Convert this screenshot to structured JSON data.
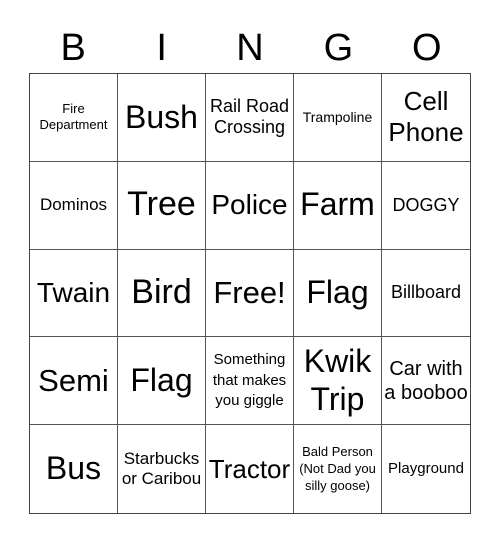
{
  "header": {
    "letters": [
      "B",
      "I",
      "N",
      "G",
      "O"
    ]
  },
  "grid": {
    "cells": [
      "Fire Department",
      "Bush",
      "Rail Road Crossing",
      "Trampoline",
      "Cell Phone",
      "Dominos",
      "Tree",
      "Police",
      "Farm",
      "DOGGY",
      "Twain",
      "Bird",
      "Free!",
      "Flag",
      "Billboard",
      "Semi",
      "Flag",
      "Something that makes you giggle",
      "Kwik Trip",
      "Car with a booboo",
      "Bus",
      "Starbucks or Caribou",
      "Tractor",
      "Bald Person (Not Dad you silly goose)",
      "Playground"
    ]
  }
}
